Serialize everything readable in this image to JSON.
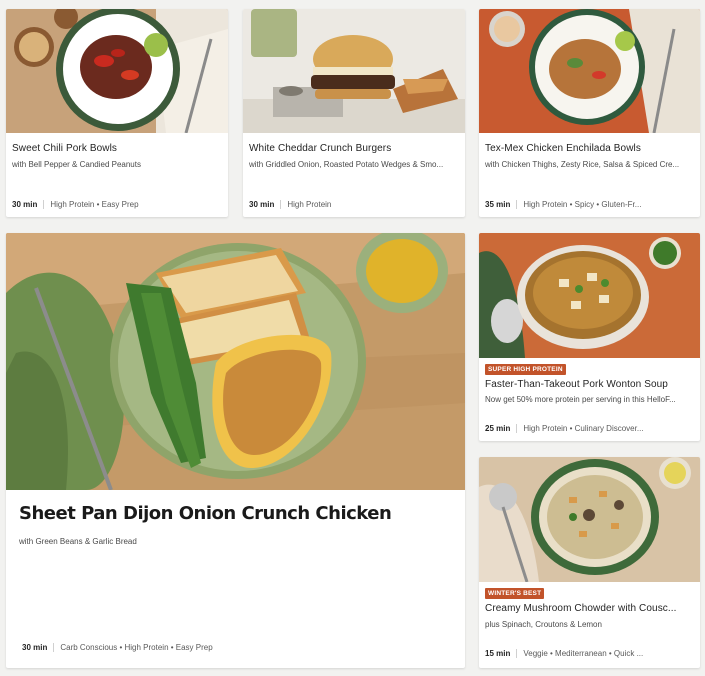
{
  "recipes": [
    {
      "title": "Sweet Chili Pork Bowls",
      "subtitle": "with Bell Pepper & Candied Peanuts",
      "time": "30 min",
      "tags": "High Protein • Easy Prep"
    },
    {
      "title": "White Cheddar Crunch Burgers",
      "subtitle": "with Griddled Onion, Roasted Potato Wedges & Smo...",
      "time": "30 min",
      "tags": "High Protein"
    },
    {
      "title": "Tex-Mex Chicken Enchilada Bowls",
      "subtitle": "with Chicken Thighs, Zesty Rice, Salsa & Spiced Cre...",
      "time": "35 min",
      "tags": "High Protein • Spicy • Gluten-Fr..."
    },
    {
      "title": "Sheet Pan Dijon Onion Crunch Chicken",
      "subtitle": "with Green Beans & Garlic Bread",
      "time": "30 min",
      "tags": "Carb Conscious • High Protein • Easy Prep"
    },
    {
      "badge": "SUPER HIGH PROTEIN",
      "title": "Faster-Than-Takeout Pork Wonton Soup",
      "subtitle": "Now get 50% more protein per serving in this HelloF...",
      "time": "25 min",
      "tags": "High Protein • Culinary Discover..."
    },
    {
      "badge": "WINTER'S BEST",
      "title": "Creamy Mushroom Chowder with Cousc...",
      "subtitle": "plus Spinach, Croutons & Lemon",
      "time": "15 min",
      "tags": "Veggie • Mediterranean • Quick ..."
    }
  ],
  "colors": {
    "badge": "#c2532a",
    "card": "#ffffff",
    "page": "#f2f2f0"
  },
  "icons": [
    "pork-bowl-photo",
    "burger-photo",
    "enchilada-bowl-photo",
    "dijon-chicken-photo",
    "wonton-soup-photo",
    "mushroom-chowder-photo"
  ]
}
